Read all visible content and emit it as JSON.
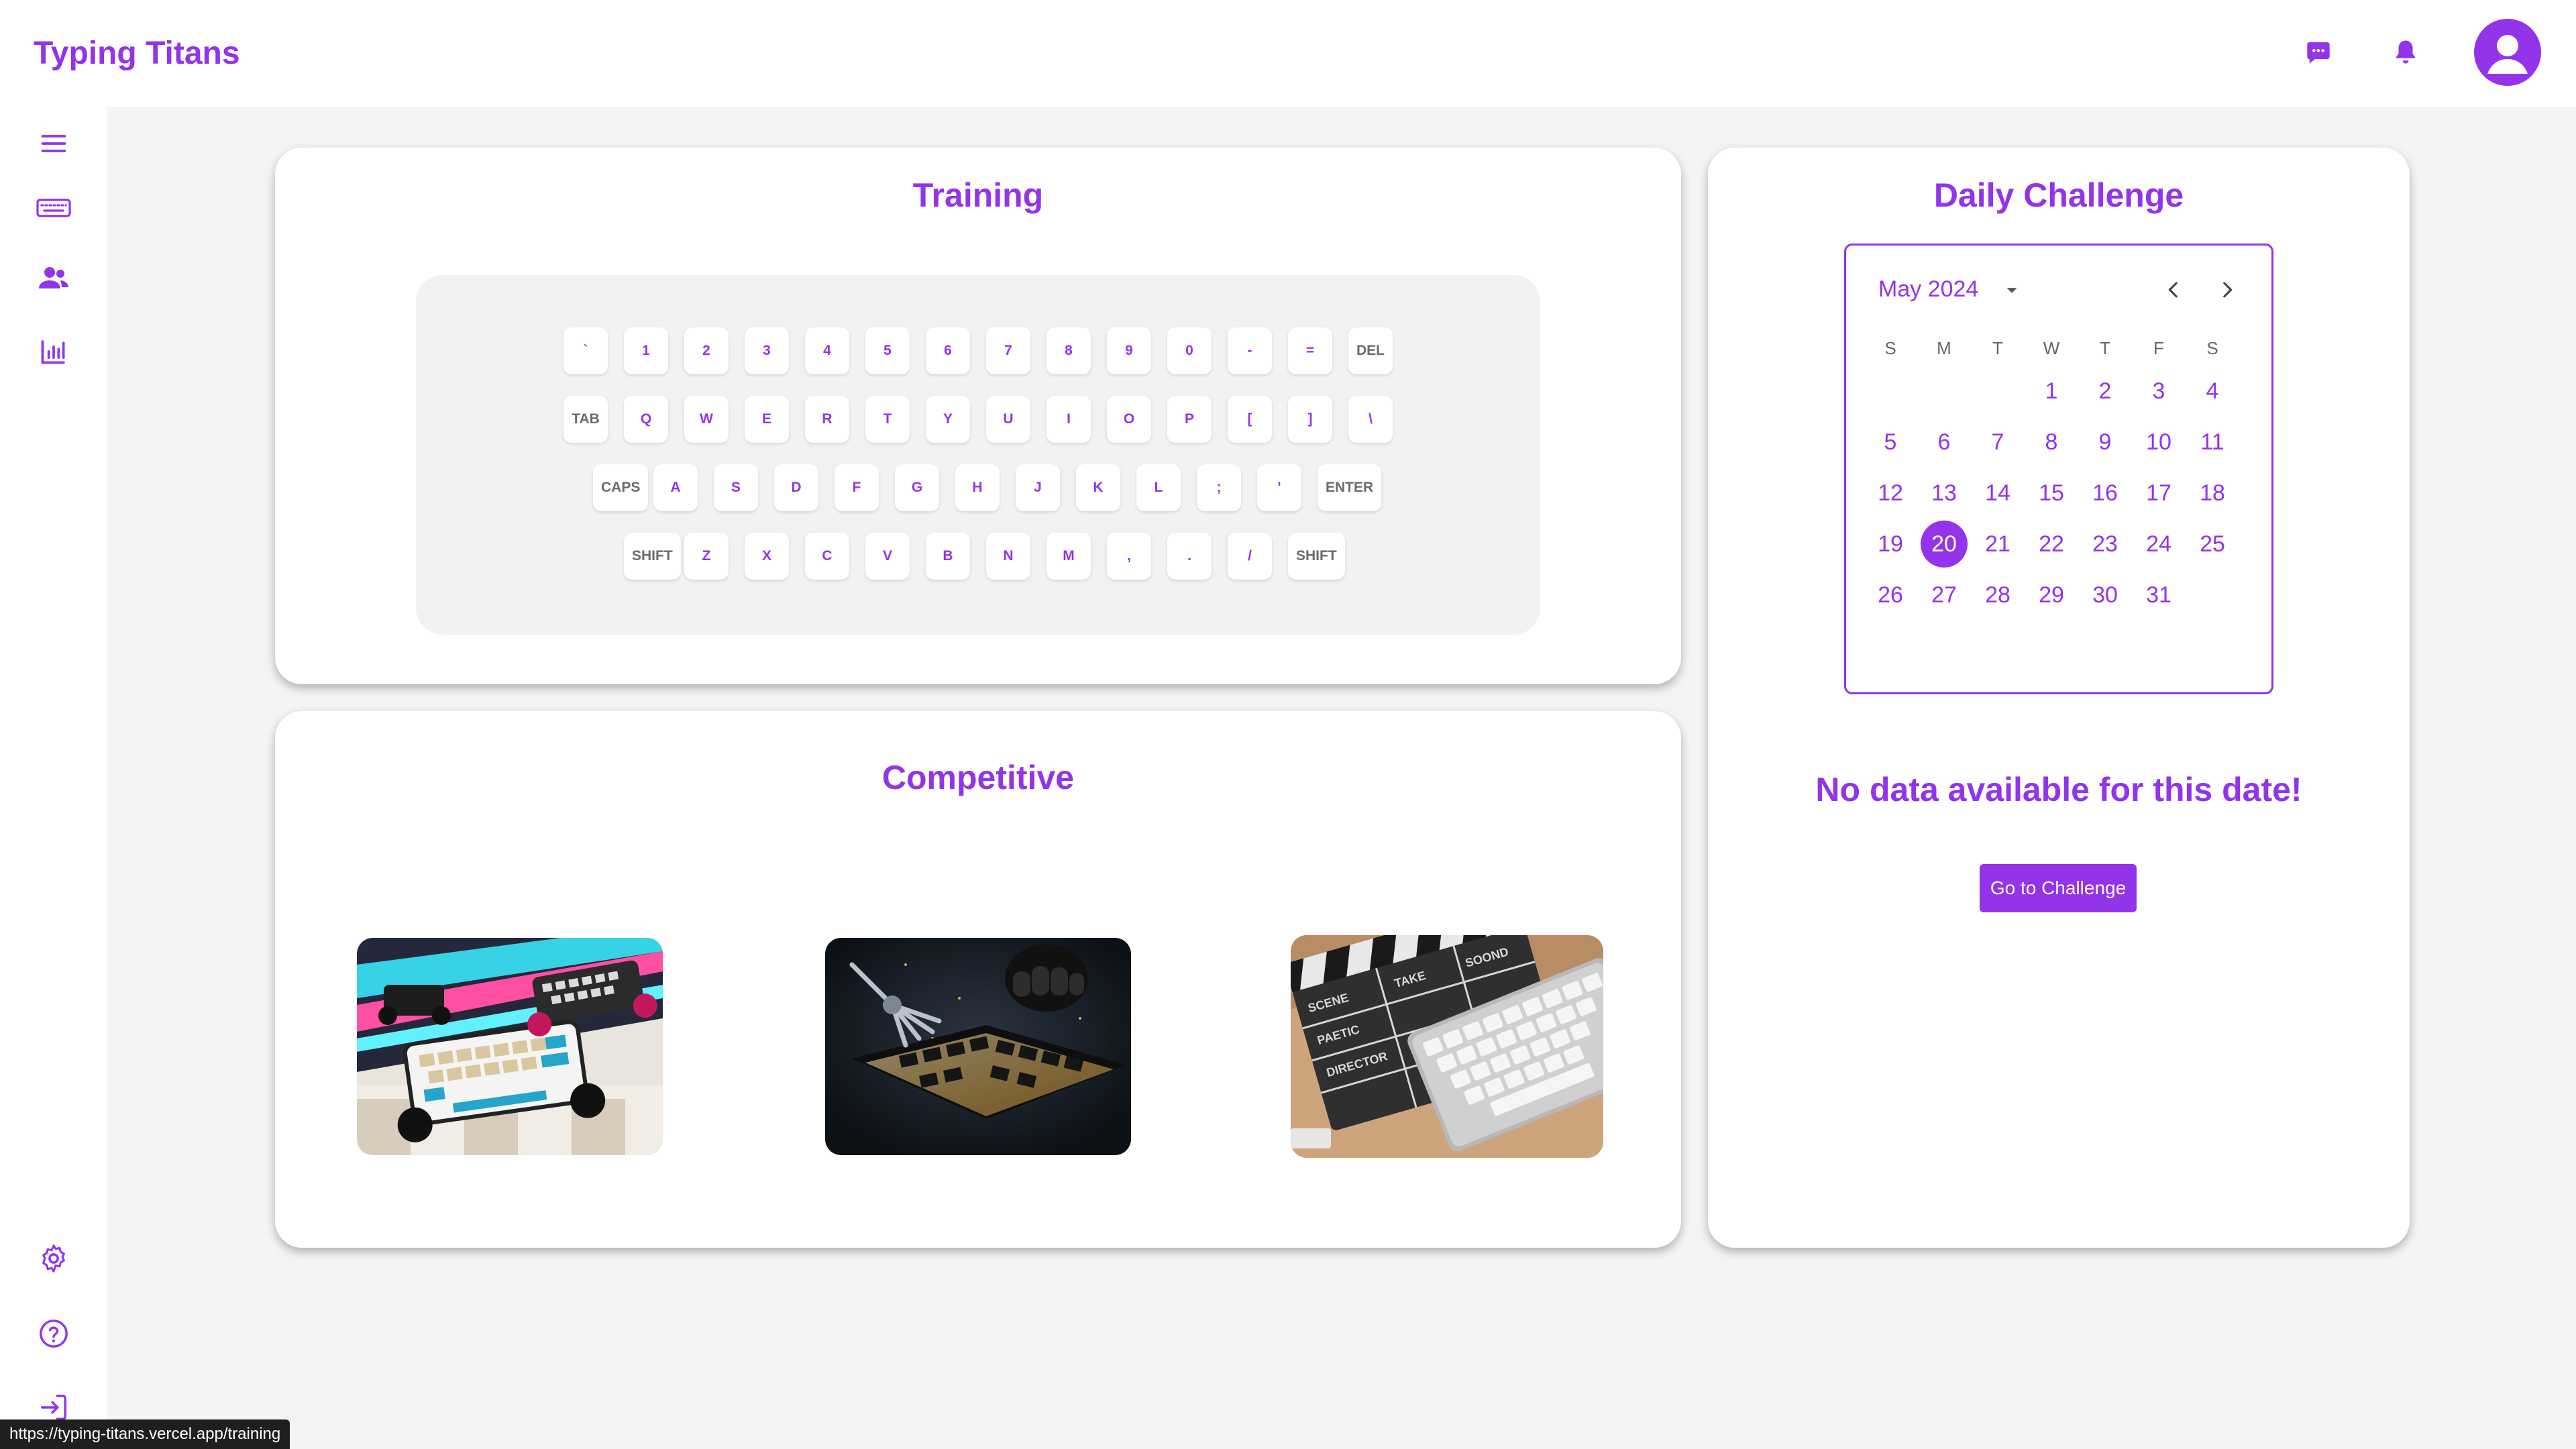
{
  "app": {
    "title": "Typing Titans",
    "accent": "#9333ea"
  },
  "topbar": {
    "icons": [
      "chat-icon",
      "bell-icon",
      "avatar"
    ]
  },
  "sidebar": {
    "top_items": [
      "menu-icon",
      "keyboard-icon",
      "users-icon",
      "chart-icon"
    ],
    "bottom_items": [
      "settings-icon",
      "help-icon",
      "logout-icon"
    ]
  },
  "training": {
    "title": "Training",
    "rows": [
      [
        "`",
        "1",
        "2",
        "3",
        "4",
        "5",
        "6",
        "7",
        "8",
        "9",
        "0",
        "-",
        "=",
        "DEL"
      ],
      [
        "TAB",
        "Q",
        "W",
        "E",
        "R",
        "T",
        "Y",
        "U",
        "I",
        "O",
        "P",
        "[",
        "]",
        "\\"
      ],
      [
        "CAPS",
        "A",
        "S",
        "D",
        "F",
        "G",
        "H",
        "J",
        "K",
        "L",
        ";",
        "'",
        "ENTER"
      ],
      [
        "SHIFT",
        "Z",
        "X",
        "C",
        "V",
        "B",
        "N",
        "M",
        ",",
        ".",
        "/",
        "SHIFT"
      ]
    ]
  },
  "competitive": {
    "title": "Competitive",
    "modes": [
      "racing-keyboards-image",
      "robot-keyboard-image",
      "clapperboard-keyboard-image"
    ]
  },
  "daily": {
    "title": "Daily Challenge",
    "calendar": {
      "month_label": "May 2024",
      "weekdays": [
        "S",
        "M",
        "T",
        "W",
        "T",
        "F",
        "S"
      ],
      "first_weekday_index": 3,
      "days_in_month": 31,
      "selected_day": 20
    },
    "message": "No data available for this date!",
    "button_label": "Go to Challenge"
  },
  "status_bar": {
    "url": "https://typing-titans.vercel.app/training"
  }
}
